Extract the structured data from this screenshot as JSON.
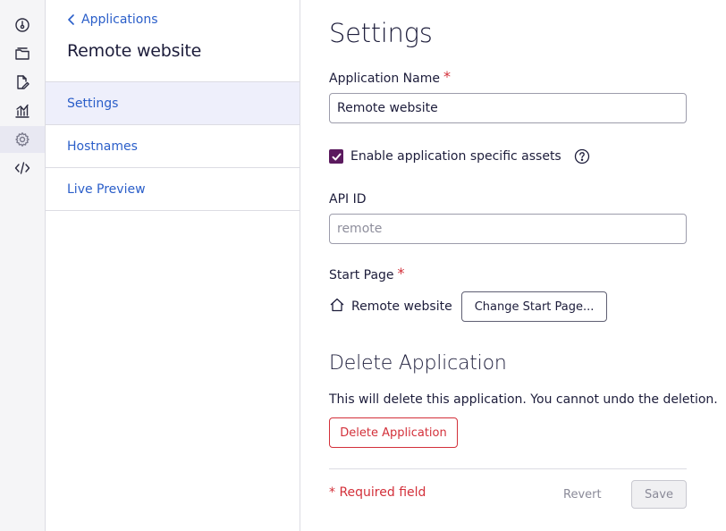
{
  "rail": {
    "items": [
      {
        "icon": "dashboard-gauge-icon"
      },
      {
        "icon": "folder-stack-icon"
      },
      {
        "icon": "edit-document-icon"
      },
      {
        "icon": "analytics-chart-icon"
      },
      {
        "icon": "gear-icon",
        "active": true
      },
      {
        "icon": "code-icon"
      }
    ]
  },
  "sidebar": {
    "back_label": "Applications",
    "app_title": "Remote website",
    "nav": [
      {
        "label": "Settings",
        "active": true
      },
      {
        "label": "Hostnames"
      },
      {
        "label": "Live Preview"
      }
    ]
  },
  "main": {
    "title": "Settings",
    "app_name": {
      "label": "Application Name",
      "required_mark": "*",
      "value": "Remote website"
    },
    "assets": {
      "label": "Enable application specific assets",
      "checked": true
    },
    "api_id": {
      "label": "API ID",
      "placeholder": "remote"
    },
    "start_page": {
      "label": "Start Page",
      "required_mark": "*",
      "page_name": "Remote website",
      "change_label": "Change Start Page..."
    },
    "delete": {
      "title": "Delete Application",
      "description": "This will delete this application. You cannot undo the deletion.",
      "button_label": "Delete Application"
    },
    "footer": {
      "required_note": "* Required field",
      "revert_label": "Revert",
      "save_label": "Save"
    }
  },
  "colors": {
    "accent_link": "#2a5ec9",
    "checkbox": "#5b1a5e",
    "danger": "#d3303a",
    "text": "#1d1d3b"
  }
}
